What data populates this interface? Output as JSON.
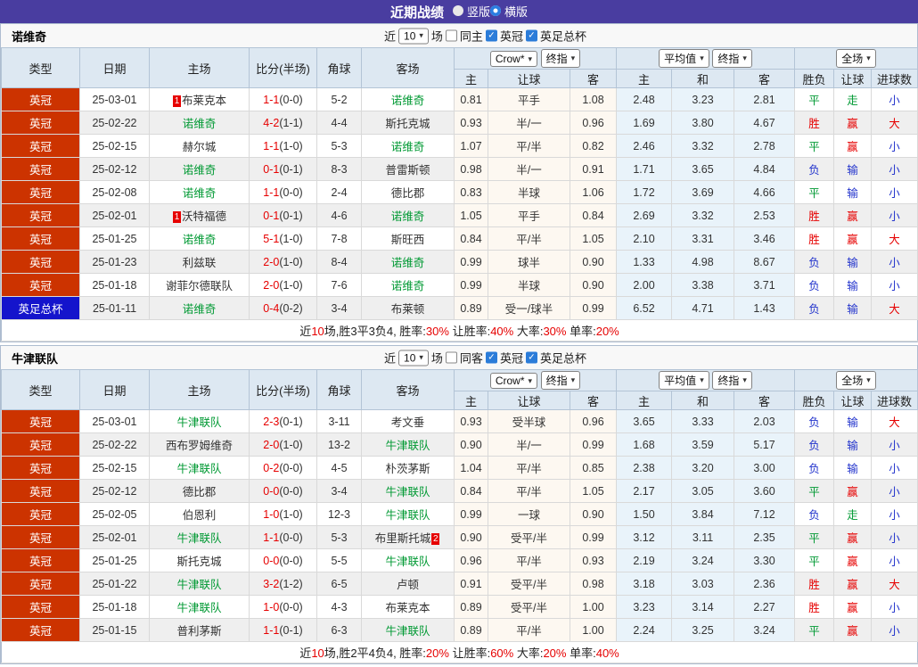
{
  "topbar": {
    "title": "近期战绩",
    "options": [
      {
        "label": "竖版",
        "selected": false
      },
      {
        "label": "横版",
        "selected": true
      }
    ]
  },
  "colors": {
    "topbar_bg": "#493da0",
    "league_bg": "#cc3300",
    "cup_bg": "#1414cc",
    "team_green": "#009933",
    "score_red": "#e60000",
    "result": {
      "胜": "#e60000",
      "平": "#009933",
      "负": "#2233cc",
      "赢": "#e60000",
      "走": "#009933",
      "输": "#2233cc",
      "大": "#e60000",
      "小": "#2233cc"
    }
  },
  "columns": {
    "type": "类型",
    "date": "日期",
    "home": "主场",
    "score": "比分(半场)",
    "corner": "角球",
    "away": "客场",
    "sub": [
      "主",
      "让球",
      "客",
      "主",
      "和",
      "客",
      "胜负",
      "让球",
      "进球数"
    ],
    "dropdowns": {
      "crow": "Crow*",
      "final1": "终指",
      "avg": "平均值",
      "final2": "终指",
      "scope": "全场"
    }
  },
  "tables": [
    {
      "team": "诺维奇",
      "filter": {
        "near": "近",
        "count": "10",
        "matches": "场",
        "same": "同主",
        "same_checked": false,
        "leagues": [
          {
            "label": "英冠",
            "checked": true
          },
          {
            "label": "英足总杯",
            "checked": true
          }
        ]
      },
      "rows": [
        {
          "type": "英冠",
          "type_key": "league",
          "date": "25-03-01",
          "home": "布莱克本",
          "home_team": false,
          "home_badge": "1",
          "score": "1-1",
          "half": "(0-0)",
          "corner": "5-2",
          "away": "诺维奇",
          "away_team": true,
          "odds": [
            "0.81",
            "平手",
            "1.08"
          ],
          "avg": [
            "2.48",
            "3.23",
            "2.81"
          ],
          "results": [
            "平",
            "走",
            "小"
          ]
        },
        {
          "type": "英冠",
          "type_key": "league",
          "date": "25-02-22",
          "home": "诺维奇",
          "home_team": true,
          "score": "4-2",
          "half": "(1-1)",
          "corner": "4-4",
          "away": "斯托克城",
          "away_team": false,
          "odds": [
            "0.93",
            "半/一",
            "0.96"
          ],
          "avg": [
            "1.69",
            "3.80",
            "4.67"
          ],
          "results": [
            "胜",
            "赢",
            "大"
          ]
        },
        {
          "type": "英冠",
          "type_key": "league",
          "date": "25-02-15",
          "home": "赫尔城",
          "home_team": false,
          "score": "1-1",
          "half": "(1-0)",
          "corner": "5-3",
          "away": "诺维奇",
          "away_team": true,
          "odds": [
            "1.07",
            "平/半",
            "0.82"
          ],
          "avg": [
            "2.46",
            "3.32",
            "2.78"
          ],
          "results": [
            "平",
            "赢",
            "小"
          ]
        },
        {
          "type": "英冠",
          "type_key": "league",
          "date": "25-02-12",
          "home": "诺维奇",
          "home_team": true,
          "score": "0-1",
          "half": "(0-1)",
          "corner": "8-3",
          "away": "普雷斯顿",
          "away_team": false,
          "odds": [
            "0.98",
            "半/一",
            "0.91"
          ],
          "avg": [
            "1.71",
            "3.65",
            "4.84"
          ],
          "results": [
            "负",
            "输",
            "小"
          ]
        },
        {
          "type": "英冠",
          "type_key": "league",
          "date": "25-02-08",
          "home": "诺维奇",
          "home_team": true,
          "score": "1-1",
          "half": "(0-0)",
          "corner": "2-4",
          "away": "德比郡",
          "away_team": false,
          "odds": [
            "0.83",
            "半球",
            "1.06"
          ],
          "avg": [
            "1.72",
            "3.69",
            "4.66"
          ],
          "results": [
            "平",
            "输",
            "小"
          ]
        },
        {
          "type": "英冠",
          "type_key": "league",
          "date": "25-02-01",
          "home": "沃特福德",
          "home_team": false,
          "home_badge": "1",
          "score": "0-1",
          "half": "(0-1)",
          "corner": "4-6",
          "away": "诺维奇",
          "away_team": true,
          "odds": [
            "1.05",
            "平手",
            "0.84"
          ],
          "avg": [
            "2.69",
            "3.32",
            "2.53"
          ],
          "results": [
            "胜",
            "赢",
            "小"
          ]
        },
        {
          "type": "英冠",
          "type_key": "league",
          "date": "25-01-25",
          "home": "诺维奇",
          "home_team": true,
          "score": "5-1",
          "half": "(1-0)",
          "corner": "7-8",
          "away": "斯旺西",
          "away_team": false,
          "odds": [
            "0.84",
            "平/半",
            "1.05"
          ],
          "avg": [
            "2.10",
            "3.31",
            "3.46"
          ],
          "results": [
            "胜",
            "赢",
            "大"
          ]
        },
        {
          "type": "英冠",
          "type_key": "league",
          "date": "25-01-23",
          "home": "利兹联",
          "home_team": false,
          "score": "2-0",
          "half": "(1-0)",
          "corner": "8-4",
          "away": "诺维奇",
          "away_team": true,
          "odds": [
            "0.99",
            "球半",
            "0.90"
          ],
          "avg": [
            "1.33",
            "4.98",
            "8.67"
          ],
          "results": [
            "负",
            "输",
            "小"
          ]
        },
        {
          "type": "英冠",
          "type_key": "league",
          "date": "25-01-18",
          "home": "谢菲尔德联队",
          "home_team": false,
          "score": "2-0",
          "half": "(1-0)",
          "corner": "7-6",
          "away": "诺维奇",
          "away_team": true,
          "odds": [
            "0.99",
            "半球",
            "0.90"
          ],
          "avg": [
            "2.00",
            "3.38",
            "3.71"
          ],
          "results": [
            "负",
            "输",
            "小"
          ]
        },
        {
          "type": "英足总杯",
          "type_key": "cup",
          "date": "25-01-11",
          "home": "诺维奇",
          "home_team": true,
          "score": "0-4",
          "half": "(0-2)",
          "corner": "3-4",
          "away": "布莱顿",
          "away_team": false,
          "odds": [
            "0.89",
            "受一/球半",
            "0.99"
          ],
          "avg": [
            "6.52",
            "4.71",
            "1.43"
          ],
          "results": [
            "负",
            "输",
            "大"
          ]
        }
      ],
      "summary": [
        {
          "t": "近",
          "red": false
        },
        {
          "t": "10",
          "red": true
        },
        {
          "t": "场,胜3平3负4, 胜率:",
          "red": false
        },
        {
          "t": "30%",
          "red": true
        },
        {
          "t": " 让胜率:",
          "red": false
        },
        {
          "t": "40%",
          "red": true
        },
        {
          "t": " 大率:",
          "red": false
        },
        {
          "t": "30%",
          "red": true
        },
        {
          "t": " 单率:",
          "red": false
        },
        {
          "t": "20%",
          "red": true
        }
      ]
    },
    {
      "team": "牛津联队",
      "filter": {
        "near": "近",
        "count": "10",
        "matches": "场",
        "same": "同客",
        "same_checked": false,
        "leagues": [
          {
            "label": "英冠",
            "checked": true
          },
          {
            "label": "英足总杯",
            "checked": true
          }
        ]
      },
      "rows": [
        {
          "type": "英冠",
          "type_key": "league",
          "date": "25-03-01",
          "home": "牛津联队",
          "home_team": true,
          "score": "2-3",
          "half": "(0-1)",
          "corner": "3-11",
          "away": "考文垂",
          "away_team": false,
          "odds": [
            "0.93",
            "受半球",
            "0.96"
          ],
          "avg": [
            "3.65",
            "3.33",
            "2.03"
          ],
          "results": [
            "负",
            "输",
            "大"
          ]
        },
        {
          "type": "英冠",
          "type_key": "league",
          "date": "25-02-22",
          "home": "西布罗姆维奇",
          "home_team": false,
          "score": "2-0",
          "half": "(1-0)",
          "corner": "13-2",
          "away": "牛津联队",
          "away_team": true,
          "odds": [
            "0.90",
            "半/一",
            "0.99"
          ],
          "avg": [
            "1.68",
            "3.59",
            "5.17"
          ],
          "results": [
            "负",
            "输",
            "小"
          ]
        },
        {
          "type": "英冠",
          "type_key": "league",
          "date": "25-02-15",
          "home": "牛津联队",
          "home_team": true,
          "score": "0-2",
          "half": "(0-0)",
          "corner": "4-5",
          "away": "朴茨茅斯",
          "away_team": false,
          "odds": [
            "1.04",
            "平/半",
            "0.85"
          ],
          "avg": [
            "2.38",
            "3.20",
            "3.00"
          ],
          "results": [
            "负",
            "输",
            "小"
          ]
        },
        {
          "type": "英冠",
          "type_key": "league",
          "date": "25-02-12",
          "home": "德比郡",
          "home_team": false,
          "score": "0-0",
          "half": "(0-0)",
          "corner": "3-4",
          "away": "牛津联队",
          "away_team": true,
          "odds": [
            "0.84",
            "平/半",
            "1.05"
          ],
          "avg": [
            "2.17",
            "3.05",
            "3.60"
          ],
          "results": [
            "平",
            "赢",
            "小"
          ]
        },
        {
          "type": "英冠",
          "type_key": "league",
          "date": "25-02-05",
          "home": "伯恩利",
          "home_team": false,
          "score": "1-0",
          "half": "(1-0)",
          "corner": "12-3",
          "away": "牛津联队",
          "away_team": true,
          "odds": [
            "0.99",
            "一球",
            "0.90"
          ],
          "avg": [
            "1.50",
            "3.84",
            "7.12"
          ],
          "results": [
            "负",
            "走",
            "小"
          ]
        },
        {
          "type": "英冠",
          "type_key": "league",
          "date": "25-02-01",
          "home": "牛津联队",
          "home_team": true,
          "score": "1-1",
          "half": "(0-0)",
          "corner": "5-3",
          "away": "布里斯托城",
          "away_team": false,
          "away_badge": "2",
          "odds": [
            "0.90",
            "受平/半",
            "0.99"
          ],
          "avg": [
            "3.12",
            "3.11",
            "2.35"
          ],
          "results": [
            "平",
            "赢",
            "小"
          ]
        },
        {
          "type": "英冠",
          "type_key": "league",
          "date": "25-01-25",
          "home": "斯托克城",
          "home_team": false,
          "score": "0-0",
          "half": "(0-0)",
          "corner": "5-5",
          "away": "牛津联队",
          "away_team": true,
          "odds": [
            "0.96",
            "平/半",
            "0.93"
          ],
          "avg": [
            "2.19",
            "3.24",
            "3.30"
          ],
          "results": [
            "平",
            "赢",
            "小"
          ]
        },
        {
          "type": "英冠",
          "type_key": "league",
          "date": "25-01-22",
          "home": "牛津联队",
          "home_team": true,
          "score": "3-2",
          "half": "(1-2)",
          "corner": "6-5",
          "away": "卢顿",
          "away_team": false,
          "odds": [
            "0.91",
            "受平/半",
            "0.98"
          ],
          "avg": [
            "3.18",
            "3.03",
            "2.36"
          ],
          "results": [
            "胜",
            "赢",
            "大"
          ]
        },
        {
          "type": "英冠",
          "type_key": "league",
          "date": "25-01-18",
          "home": "牛津联队",
          "home_team": true,
          "score": "1-0",
          "half": "(0-0)",
          "corner": "4-3",
          "away": "布莱克本",
          "away_team": false,
          "odds": [
            "0.89",
            "受平/半",
            "1.00"
          ],
          "avg": [
            "3.23",
            "3.14",
            "2.27"
          ],
          "results": [
            "胜",
            "赢",
            "小"
          ]
        },
        {
          "type": "英冠",
          "type_key": "league",
          "date": "25-01-15",
          "home": "普利茅斯",
          "home_team": false,
          "score": "1-1",
          "half": "(0-1)",
          "corner": "6-3",
          "away": "牛津联队",
          "away_team": true,
          "odds": [
            "0.89",
            "平/半",
            "1.00"
          ],
          "avg": [
            "2.24",
            "3.25",
            "3.24"
          ],
          "results": [
            "平",
            "赢",
            "小"
          ]
        }
      ],
      "summary": [
        {
          "t": "近",
          "red": false
        },
        {
          "t": "10",
          "red": true
        },
        {
          "t": "场,胜2平4负4, 胜率:",
          "red": false
        },
        {
          "t": "20%",
          "red": true
        },
        {
          "t": " 让胜率:",
          "red": false
        },
        {
          "t": "60%",
          "red": true
        },
        {
          "t": " 大率:",
          "red": false
        },
        {
          "t": "20%",
          "red": true
        },
        {
          "t": " 单率:",
          "red": false
        },
        {
          "t": "40%",
          "red": true
        }
      ]
    }
  ]
}
